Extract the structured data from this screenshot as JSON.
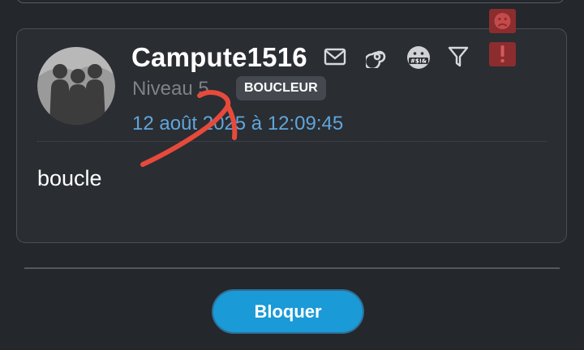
{
  "post": {
    "username": "Campute1516",
    "level": "Niveau 5",
    "date": "12 août 2025 à 12:09:45",
    "content": "boucle",
    "tooltip": "BOUCLEUR"
  },
  "icons": {
    "message": "envelope-icon",
    "spiral": "spiral-icon",
    "badge": "censored-face-icon",
    "badge_text": "#$!&",
    "filter": "filter-icon",
    "sad": "sad-face-icon",
    "report": "exclamation-icon"
  },
  "actions": {
    "block_label": "Bloquer"
  },
  "colors": {
    "background": "#24272c",
    "accent": "#1a9ad6",
    "date": "#5fa6dc",
    "danger": "#8b2d2e",
    "annotation": "#e64a3b"
  }
}
